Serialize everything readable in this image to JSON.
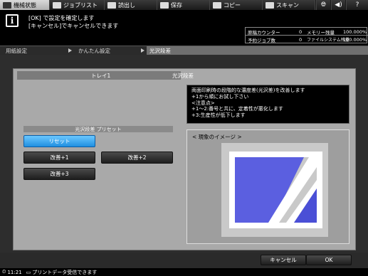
{
  "tabs": [
    {
      "label": "機械状態",
      "icon": "machine-status-icon",
      "active": true
    },
    {
      "label": "ジョブリスト",
      "icon": "job-list-icon",
      "active": false
    },
    {
      "label": "読出し",
      "icon": "recall-icon",
      "active": false
    },
    {
      "label": "保存",
      "icon": "save-icon",
      "active": false
    },
    {
      "label": "コピー",
      "icon": "copy-icon",
      "active": false
    },
    {
      "label": "スキャン",
      "icon": "scan-icon",
      "active": false
    }
  ],
  "toolbar_icons": [
    "globe-icon",
    "volume-icon",
    "help-icon"
  ],
  "message": {
    "line1": "[OK] で設定を確定します",
    "line2": "[キャンセル]でキャンセルできます"
  },
  "status": {
    "row1": {
      "label": "原稿カウンター",
      "value": "0",
      "label2": "メモリー残量",
      "value2": "100.000%"
    },
    "row2": {
      "label": "予約ジョブ数",
      "value": "0",
      "label2": "ファイルシステム残量",
      "value2": "100.000%"
    }
  },
  "breadcrumbs": [
    "用紙設定",
    "かんたん設定",
    "光沢段差"
  ],
  "tray": {
    "name": "トレイ1",
    "title": "光沢段差"
  },
  "description": [
    "両面印刷時の段階的な濃度差(光沢差)を改善します",
    "+1から順にお試し下さい",
    "<注意点>",
    "+1～2:番号と共に、定着性が悪化します",
    "+3:生産性が低下します"
  ],
  "preset": {
    "header": "光沢段差 プリセット",
    "buttons": [
      {
        "label": "リセット",
        "selected": true
      },
      {
        "label": "改善+1",
        "selected": false
      },
      {
        "label": "改善+2",
        "selected": false
      },
      {
        "label": "改善+3",
        "selected": false
      }
    ]
  },
  "image_title": "< 現象のイメージ >",
  "actions": {
    "cancel": "キャンセル",
    "ok": "OK"
  },
  "statusbar": {
    "time": "11:21",
    "message": "プリントデータ受信できます"
  },
  "colors": {
    "accent_blue": "#1f8fe0",
    "sheet_blue": "#5b5fe0",
    "sheet_blue_dark": "#4a4fd6"
  }
}
